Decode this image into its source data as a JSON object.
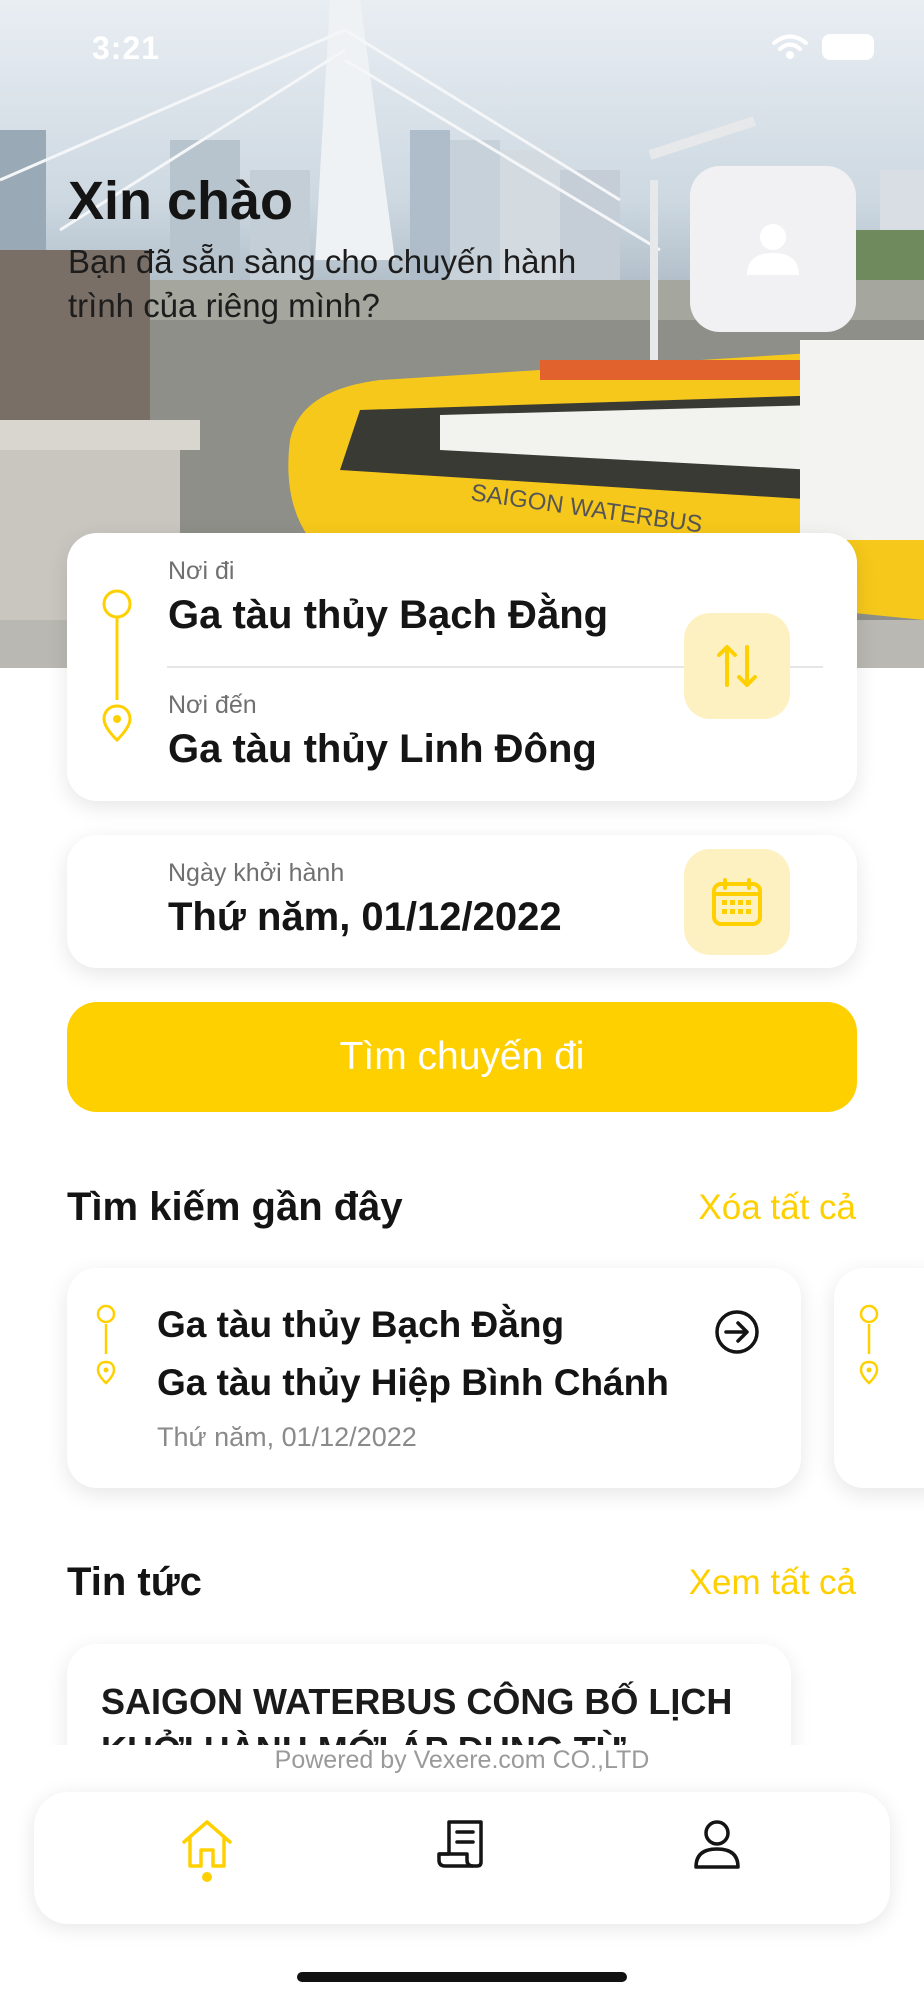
{
  "status_bar": {
    "time": "3:21"
  },
  "greeting": {
    "title": "Xin chào",
    "subtitle": "Bạn đã sẵn sàng cho chuyến hành trình của riêng mình?"
  },
  "route": {
    "from_label": "Nơi đi",
    "from_value": "Ga tàu thủy Bạch Đằng",
    "to_label": "Nơi đến",
    "to_value": "Ga tàu thủy Linh Đông"
  },
  "date": {
    "label": "Ngày khởi hành",
    "value": "Thứ năm, 01/12/2022"
  },
  "search_button": "Tìm chuyến đi",
  "recent": {
    "title": "Tìm kiếm gần đây",
    "clear_all": "Xóa tất cả",
    "items": [
      {
        "from": "Ga tàu thủy Bạch Đằng",
        "to": "Ga tàu thủy Hiệp Bình Chánh",
        "date": "Thứ năm, 01/12/2022"
      }
    ]
  },
  "news": {
    "title": "Tin tức",
    "view_all": "Xem tất cả",
    "items": [
      {
        "headline": "SAIGON WATERBUS CÔNG BỐ LỊCH KHỞI HÀNH MỚI ÁP DỤNG TỪ"
      }
    ]
  },
  "powered_by": "Powered by Vexere.com CO.,LTD",
  "hero_boat_text": "SAIGON WATERBUS",
  "colors": {
    "accent": "#ffd000",
    "accent_soft": "#fdf1c2",
    "text": "#141414",
    "muted": "#707070"
  },
  "icons": [
    "wifi-icon",
    "battery-icon",
    "user-icon",
    "swap-icon",
    "calendar-icon",
    "arrow-right-circle-icon",
    "home-icon",
    "ticket-icon",
    "profile-icon"
  ]
}
